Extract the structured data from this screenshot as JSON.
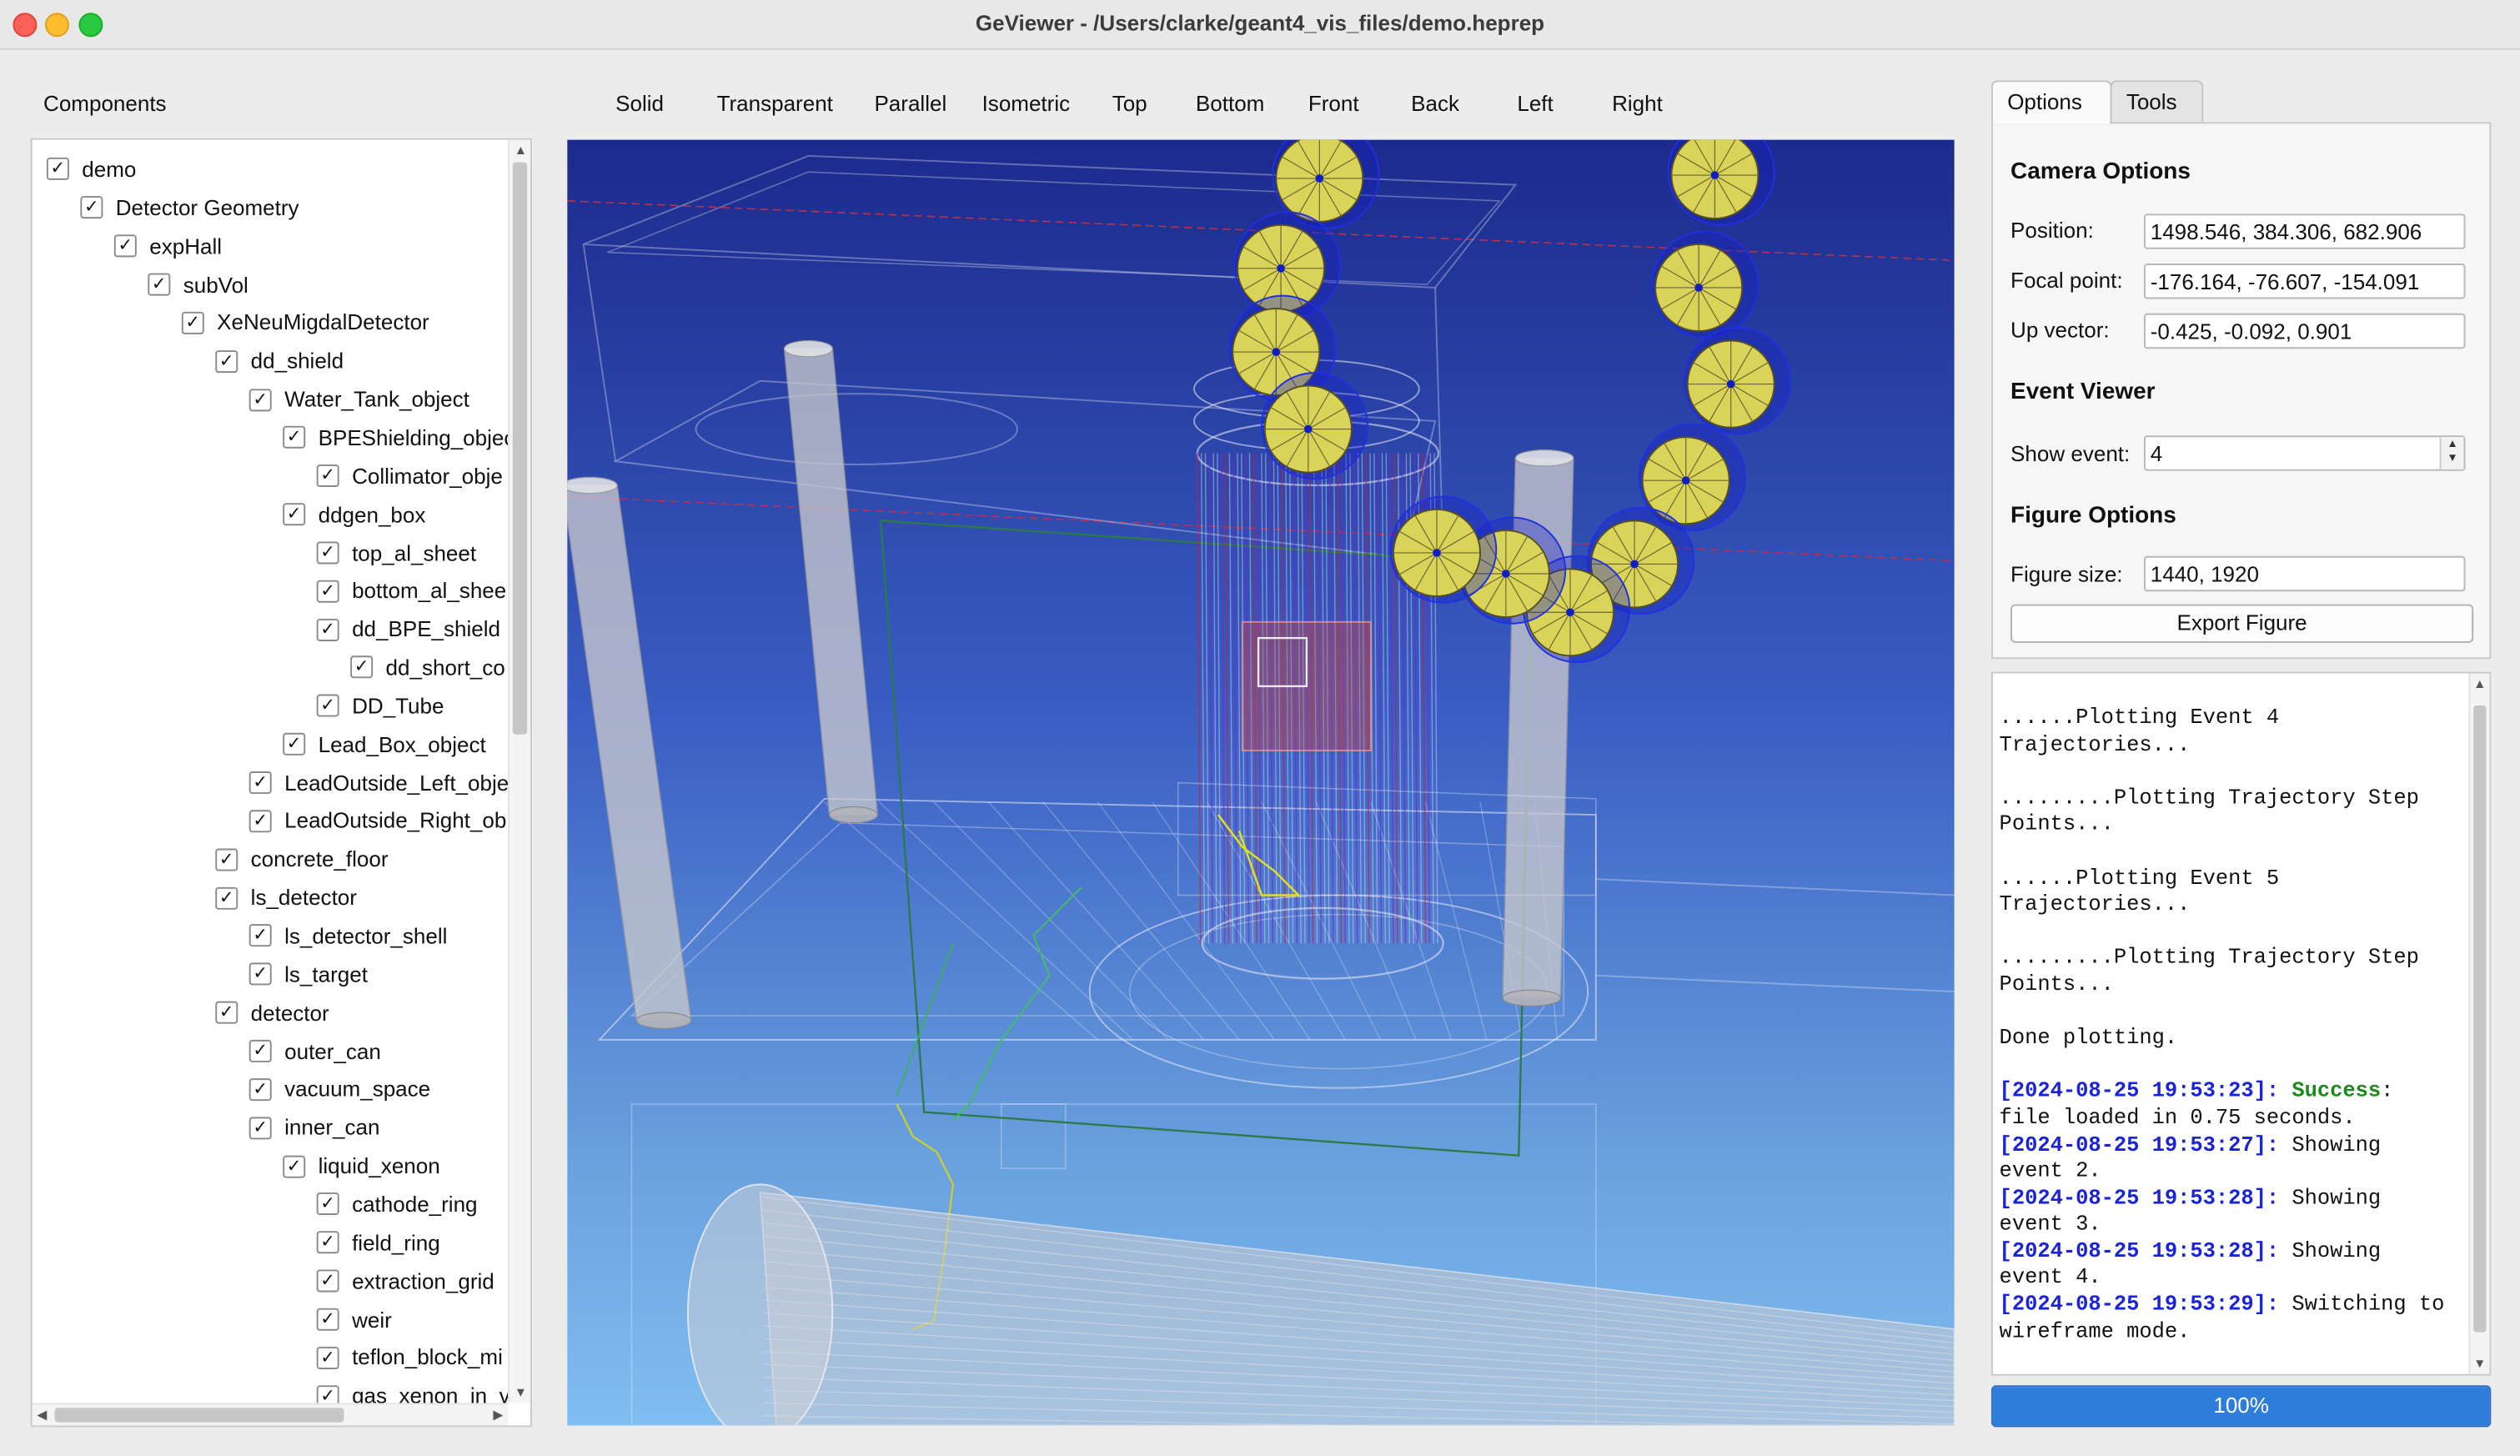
{
  "window": {
    "title": "GeViewer - /Users/clarke/geant4_vis_files/demo.heprep"
  },
  "components": {
    "label": "Components",
    "tree": [
      {
        "label": "demo",
        "level": 0
      },
      {
        "label": "Detector Geometry",
        "level": 1
      },
      {
        "label": "expHall",
        "level": 2
      },
      {
        "label": "subVol",
        "level": 3
      },
      {
        "label": "XeNeuMigdalDetector",
        "level": 4
      },
      {
        "label": "dd_shield",
        "level": 5
      },
      {
        "label": "Water_Tank_object",
        "level": 6
      },
      {
        "label": "BPEShielding_objec",
        "level": 7
      },
      {
        "label": "Collimator_obje",
        "level": 8
      },
      {
        "label": "ddgen_box",
        "level": 7
      },
      {
        "label": "top_al_sheet",
        "level": 8
      },
      {
        "label": "bottom_al_shee",
        "level": 8
      },
      {
        "label": "dd_BPE_shield",
        "level": 8
      },
      {
        "label": "dd_short_co",
        "level": 9
      },
      {
        "label": "DD_Tube",
        "level": 8
      },
      {
        "label": "Lead_Box_object",
        "level": 7
      },
      {
        "label": "LeadOutside_Left_obje",
        "level": 6
      },
      {
        "label": "LeadOutside_Right_ob",
        "level": 6
      },
      {
        "label": "concrete_floor",
        "level": 5
      },
      {
        "label": "ls_detector",
        "level": 5
      },
      {
        "label": "ls_detector_shell",
        "level": 6
      },
      {
        "label": "ls_target",
        "level": 6
      },
      {
        "label": "detector",
        "level": 5
      },
      {
        "label": "outer_can",
        "level": 6
      },
      {
        "label": "vacuum_space",
        "level": 6
      },
      {
        "label": "inner_can",
        "level": 6
      },
      {
        "label": "liquid_xenon",
        "level": 7
      },
      {
        "label": "cathode_ring",
        "level": 8
      },
      {
        "label": "field_ring",
        "level": 8
      },
      {
        "label": "extraction_grid",
        "level": 8
      },
      {
        "label": "weir",
        "level": 8
      },
      {
        "label": "teflon_block_mi",
        "level": 8
      },
      {
        "label": "gas_xenon_in_v",
        "level": 8
      }
    ],
    "check_glyph": "✓"
  },
  "toolbar": {
    "solid": "Solid",
    "transparent": "Transparent",
    "parallel": "Parallel",
    "isometric": "Isometric",
    "top": "Top",
    "bottom": "Bottom",
    "front": "Front",
    "back": "Back",
    "left": "Left",
    "right": "Right"
  },
  "tabs": {
    "options": "Options",
    "tools": "Tools"
  },
  "camera": {
    "heading": "Camera Options",
    "position_label": "Position:",
    "position_value": "1498.546, 384.306, 682.906",
    "focal_label": "Focal point:",
    "focal_value": "-176.164, -76.607, -154.091",
    "up_label": "Up vector:",
    "up_value": "-0.425, -0.092, 0.901"
  },
  "event": {
    "heading": "Event Viewer",
    "show_label": "Show event:",
    "show_value": "4"
  },
  "figure": {
    "heading": "Figure Options",
    "size_label": "Figure size:",
    "size_value": "1440, 1920",
    "export_label": "Export Figure"
  },
  "log": {
    "plain_lines": [
      "......Plotting Event 4\nTrajectories...",
      ".........Plotting Trajectory Step\nPoints...",
      "......Plotting Event 5\nTrajectories...",
      ".........Plotting Trajectory Step\nPoints...",
      "Done plotting."
    ],
    "entries": [
      {
        "ts": "[2024-08-25 19:53:23]:",
        "status": "Success",
        "after_status": ":",
        "text": "\nfile loaded in 0.75 seconds."
      },
      {
        "ts": "[2024-08-25 19:53:27]:",
        "status": "",
        "after_status": "",
        "text": " Showing\nevent 2."
      },
      {
        "ts": "[2024-08-25 19:53:28]:",
        "status": "",
        "after_status": "",
        "text": " Showing\nevent 3."
      },
      {
        "ts": "[2024-08-25 19:53:28]:",
        "status": "",
        "after_status": "",
        "text": " Showing\nevent 4."
      },
      {
        "ts": "[2024-08-25 19:53:29]:",
        "status": "",
        "after_status": "",
        "text": " Switching to\nwireframe mode."
      }
    ]
  },
  "progress": {
    "label": "100%",
    "value": 1.0
  },
  "colors": {
    "timestamp": "#1a23d6",
    "success": "#1d8a1d",
    "progress": "#2f7ddb"
  }
}
